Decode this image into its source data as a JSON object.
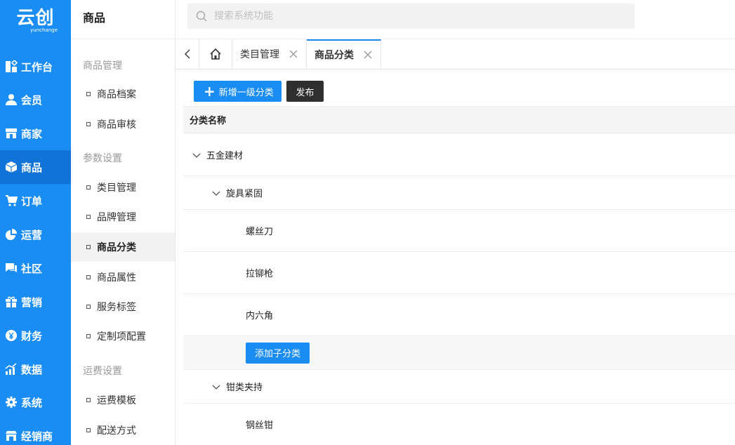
{
  "logo": {
    "main": "云创",
    "sub": "yunchange"
  },
  "nav": {
    "items": [
      {
        "label": "工作台",
        "icon": "dashboard-icon"
      },
      {
        "label": "会员",
        "icon": "user-icon"
      },
      {
        "label": "商家",
        "icon": "store-icon"
      },
      {
        "label": "商品",
        "icon": "box-icon",
        "active": true
      },
      {
        "label": "订单",
        "icon": "cart-icon"
      },
      {
        "label": "运营",
        "icon": "pie-chart-icon"
      },
      {
        "label": "社区",
        "icon": "chat-icon"
      },
      {
        "label": "营销",
        "icon": "gift-icon"
      },
      {
        "label": "财务",
        "icon": "yen-icon"
      },
      {
        "label": "数据",
        "icon": "bar-chart-icon"
      },
      {
        "label": "系统",
        "icon": "gear-icon"
      },
      {
        "label": "经销商",
        "icon": "shop-icon"
      }
    ]
  },
  "submenu": {
    "title": "商品",
    "groups": [
      {
        "label": "商品管理"
      },
      {
        "label": "参数设置"
      },
      {
        "label": "运费设置"
      }
    ],
    "items": [
      {
        "label": "商品档案"
      },
      {
        "label": "商品审核"
      },
      {
        "label": "类目管理"
      },
      {
        "label": "品牌管理"
      },
      {
        "label": "商品分类",
        "active": true
      },
      {
        "label": "商品属性"
      },
      {
        "label": "服务标签"
      },
      {
        "label": "定制项配置"
      },
      {
        "label": "运费模板"
      },
      {
        "label": "配送方式"
      }
    ]
  },
  "search": {
    "placeholder": "搜索系统功能",
    "value": ""
  },
  "tabs": [
    {
      "label": "类目管理"
    },
    {
      "label": "商品分类",
      "active": true
    }
  ],
  "toolbar": {
    "add_label": "新增一级分类",
    "publish_label": "发布"
  },
  "table": {
    "header": "分类名称",
    "rows": [
      {
        "name": "五金建材",
        "level": 1,
        "expanded": true
      },
      {
        "name": "旋具紧固",
        "level": 2,
        "expanded": true
      },
      {
        "name": "螺丝刀",
        "level": 3
      },
      {
        "name": "拉铆枪",
        "level": 3
      },
      {
        "name": "内六角",
        "level": 3
      },
      {
        "action": "添加子分类"
      },
      {
        "name": "钳类夹持",
        "level": 2,
        "expanded": true
      },
      {
        "name": "钢丝钳",
        "level": 3
      }
    ]
  },
  "colors": {
    "primary": "#1a8df5",
    "nav_active": "#0f73d7",
    "dark_button": "#2f2f2f"
  }
}
